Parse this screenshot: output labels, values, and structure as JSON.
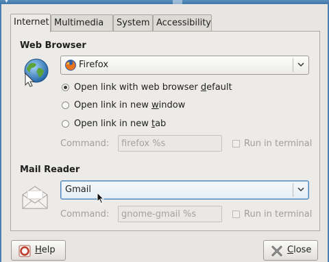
{
  "tabs": [
    {
      "label": "Internet"
    },
    {
      "label": "Multimedia"
    },
    {
      "label": "System"
    },
    {
      "label": "Accessibility"
    }
  ],
  "web_browser": {
    "title": "Web Browser",
    "selected": "Firefox",
    "options": {
      "default_pre": "Open link with web browser ",
      "default_u": "d",
      "default_post": "efault",
      "window_pre": "Open link in new ",
      "window_u": "w",
      "window_post": "indow",
      "tab_pre": "Open link in new ",
      "tab_u": "t",
      "tab_post": "ab"
    },
    "command_label": "Command:",
    "command_value": "firefox %s",
    "run_in_terminal": "Run in terminal"
  },
  "mail_reader": {
    "title": "Mail Reader",
    "selected": "Gmail",
    "command_label": "Command:",
    "command_value": "gnome-gmail %s",
    "run_in_terminal": "Run in terminal"
  },
  "buttons": {
    "help_u": "H",
    "help_rest": "elp",
    "close_u": "C",
    "close_rest": "lose"
  },
  "colors": {
    "window_bg": "#e8e6e2",
    "titlebar": "#4a7eb0",
    "focus": "#4e86bb"
  }
}
